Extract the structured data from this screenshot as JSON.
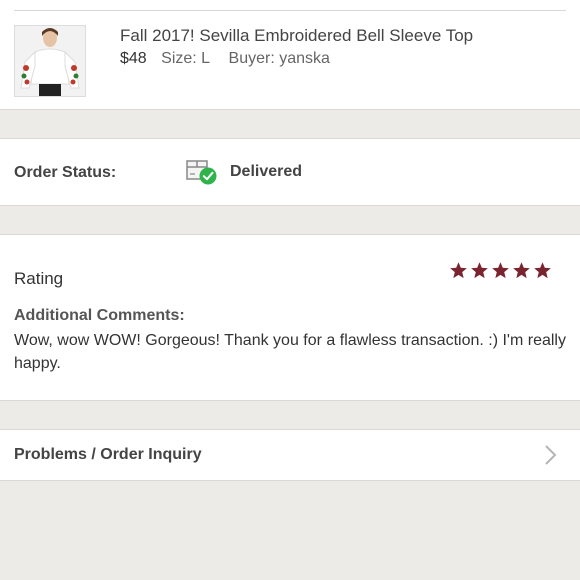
{
  "item": {
    "title": "Fall 2017! Sevilla Embroidered Bell Sleeve Top",
    "price": "$48",
    "size": "Size: L",
    "buyer": "Buyer: yanska"
  },
  "order_status": {
    "label": "Order Status:",
    "value": "Delivered",
    "icon": "box-check-icon"
  },
  "rating": {
    "label": "Rating",
    "stars": 5,
    "star_color": "#7a2430",
    "comments_label": "Additional Comments:",
    "comments": "Wow, wow WOW! Gorgeous! Thank you for a flawless transaction. :) I'm really happy."
  },
  "problems": {
    "label": "Problems / Order Inquiry",
    "icon": "chevron-right-icon"
  },
  "colors": {
    "background": "#ecebe7",
    "success": "#2fb34a",
    "accent": "#7a2430"
  }
}
